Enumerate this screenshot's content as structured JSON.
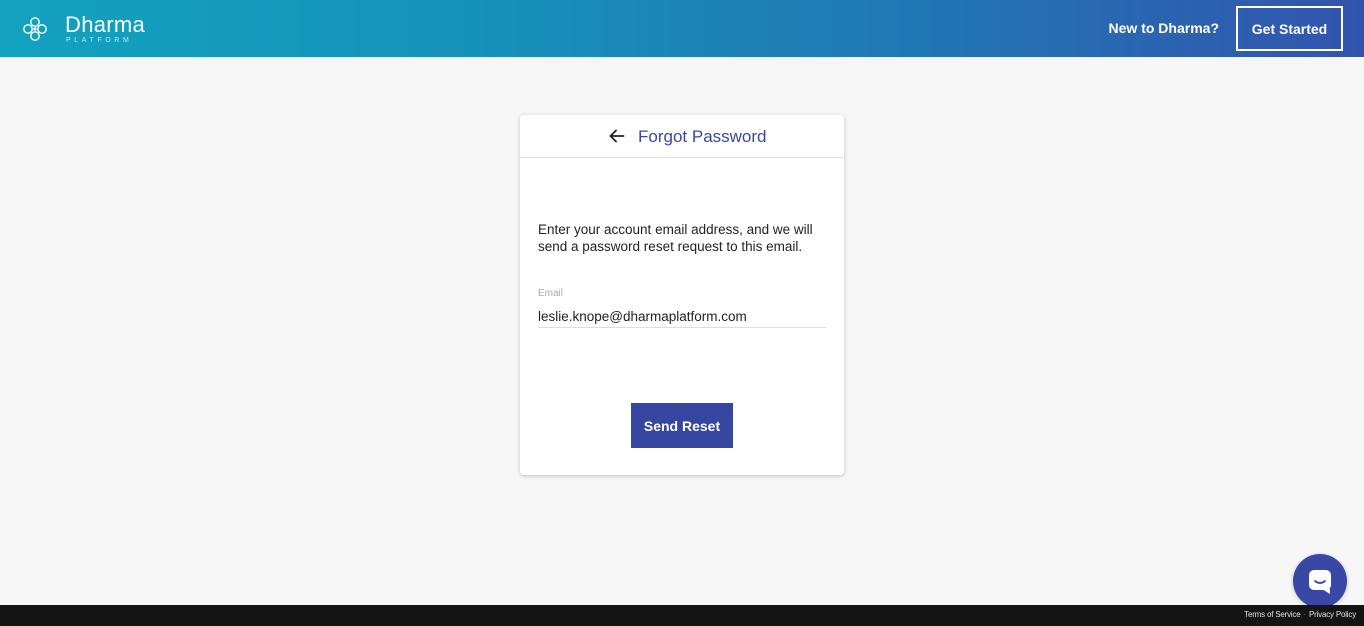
{
  "header": {
    "logo_name": "Dharma",
    "logo_sub": "PLATFORM",
    "new_to_text": "New to Dharma?",
    "get_started_label": "Get Started"
  },
  "card": {
    "title": "Forgot Password",
    "instructions": "Enter your account email address, and we will send a password reset request to this email.",
    "email_label": "Email",
    "email_value": "leslie.knope@dharmaplatform.com",
    "send_reset_label": "Send Reset"
  },
  "footer": {
    "terms_label": "Terms of Service",
    "separator": "·",
    "privacy_label": "Privacy Policy"
  },
  "icons": {
    "logo": "dharma-logo-icon",
    "back": "arrow-left-icon",
    "chat": "chat-icon"
  },
  "colors": {
    "accent": "#3646a1",
    "header_gradient_start": "#12a2bf",
    "header_gradient_end": "#3354ad",
    "title_color": "#3a47a0"
  }
}
